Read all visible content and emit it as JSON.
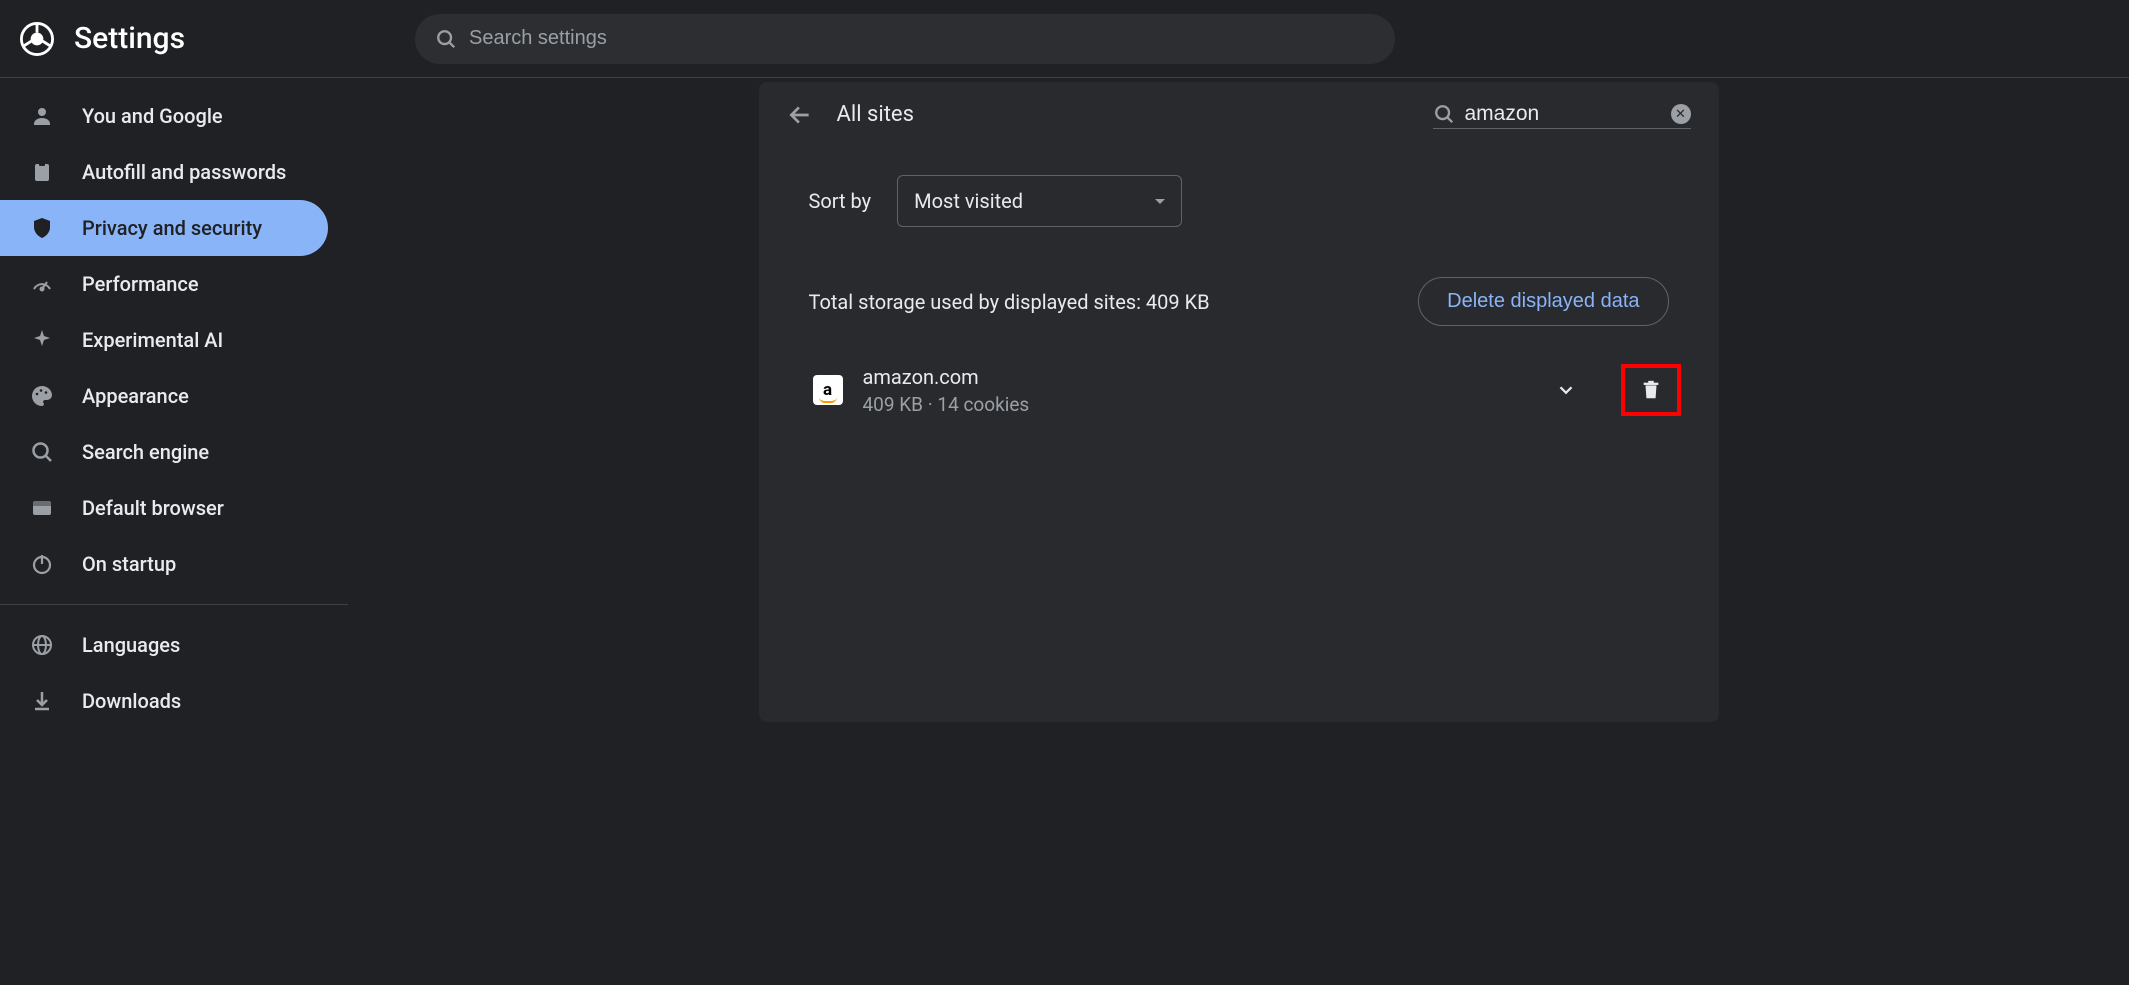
{
  "header": {
    "title": "Settings",
    "search_placeholder": "Search settings"
  },
  "sidebar": {
    "items": [
      {
        "label": "You and Google"
      },
      {
        "label": "Autofill and passwords"
      },
      {
        "label": "Privacy and security"
      },
      {
        "label": "Performance"
      },
      {
        "label": "Experimental AI"
      },
      {
        "label": "Appearance"
      },
      {
        "label": "Search engine"
      },
      {
        "label": "Default browser"
      },
      {
        "label": "On startup"
      }
    ],
    "section2": [
      {
        "label": "Languages"
      },
      {
        "label": "Downloads"
      }
    ]
  },
  "main": {
    "page_title": "All sites",
    "search_value": "amazon",
    "sort_label": "Sort by",
    "sort_value": "Most visited",
    "storage_text": "Total storage used by displayed sites: 409 KB",
    "delete_button": "Delete displayed data",
    "sites": [
      {
        "name": "amazon.com",
        "meta": "409 KB · 14 cookies",
        "favicon_letter": "a"
      }
    ]
  }
}
